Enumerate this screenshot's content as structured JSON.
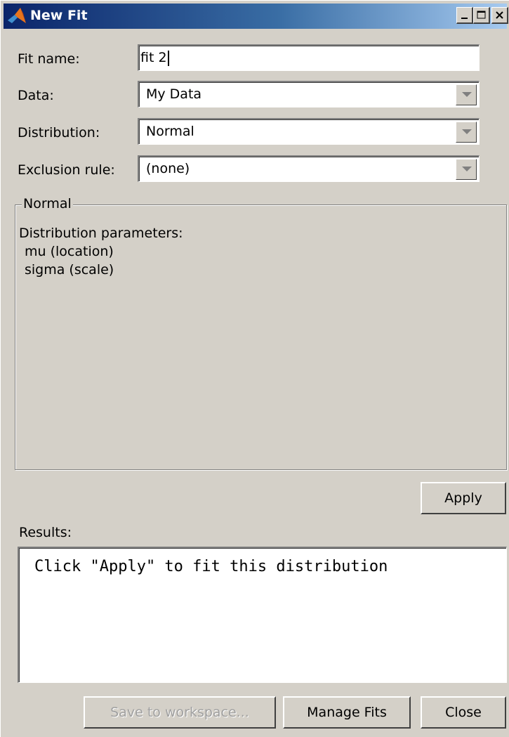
{
  "window": {
    "title": "New Fit",
    "icon": "matlab-logo-icon",
    "controls": [
      "minimize-icon",
      "maximize-icon",
      "close-icon"
    ]
  },
  "form": {
    "fit_name_label": "Fit name:",
    "fit_name_value": "fit 2",
    "data_label": "Data:",
    "data_value": "My Data",
    "distribution_label": "Distribution:",
    "distribution_value": "Normal",
    "exclusion_label": "Exclusion rule:",
    "exclusion_value": "(none)"
  },
  "group": {
    "title": "Normal",
    "heading": "Distribution parameters:",
    "params": [
      "mu (location)",
      "sigma (scale)"
    ]
  },
  "actions": {
    "apply_label": "Apply"
  },
  "results": {
    "label": "Results:",
    "text": "Click \"Apply\" to fit this distribution"
  },
  "footer": {
    "save_label": "Save to workspace...",
    "save_enabled": false,
    "manage_label": "Manage Fits",
    "close_label": "Close"
  }
}
